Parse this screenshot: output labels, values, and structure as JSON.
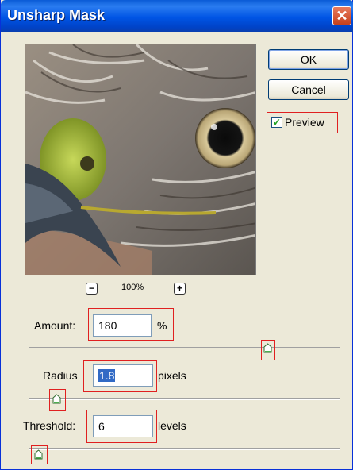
{
  "window": {
    "title": "Unsharp Mask",
    "close_glyph": "✕"
  },
  "buttons": {
    "ok": "OK",
    "cancel": "Cancel"
  },
  "preview": {
    "label": "Preview",
    "checked": true,
    "check_glyph": "✓"
  },
  "zoom": {
    "minus": "−",
    "level": "100%",
    "plus": "+"
  },
  "controls": {
    "amount": {
      "label": "Amount:",
      "value": "180",
      "unit": "%",
      "slider_fraction": 0.77
    },
    "radius": {
      "label": "Radius",
      "value": "1.8",
      "unit": "pixels",
      "slider_fraction": 0.09
    },
    "threshold": {
      "label": "Threshold:",
      "value": "6",
      "unit": "levels",
      "slider_fraction": 0.02
    }
  },
  "colors": {
    "highlight": "#e02020",
    "title_bar": "#0055e5",
    "dialog_bg": "#ece9d8"
  }
}
